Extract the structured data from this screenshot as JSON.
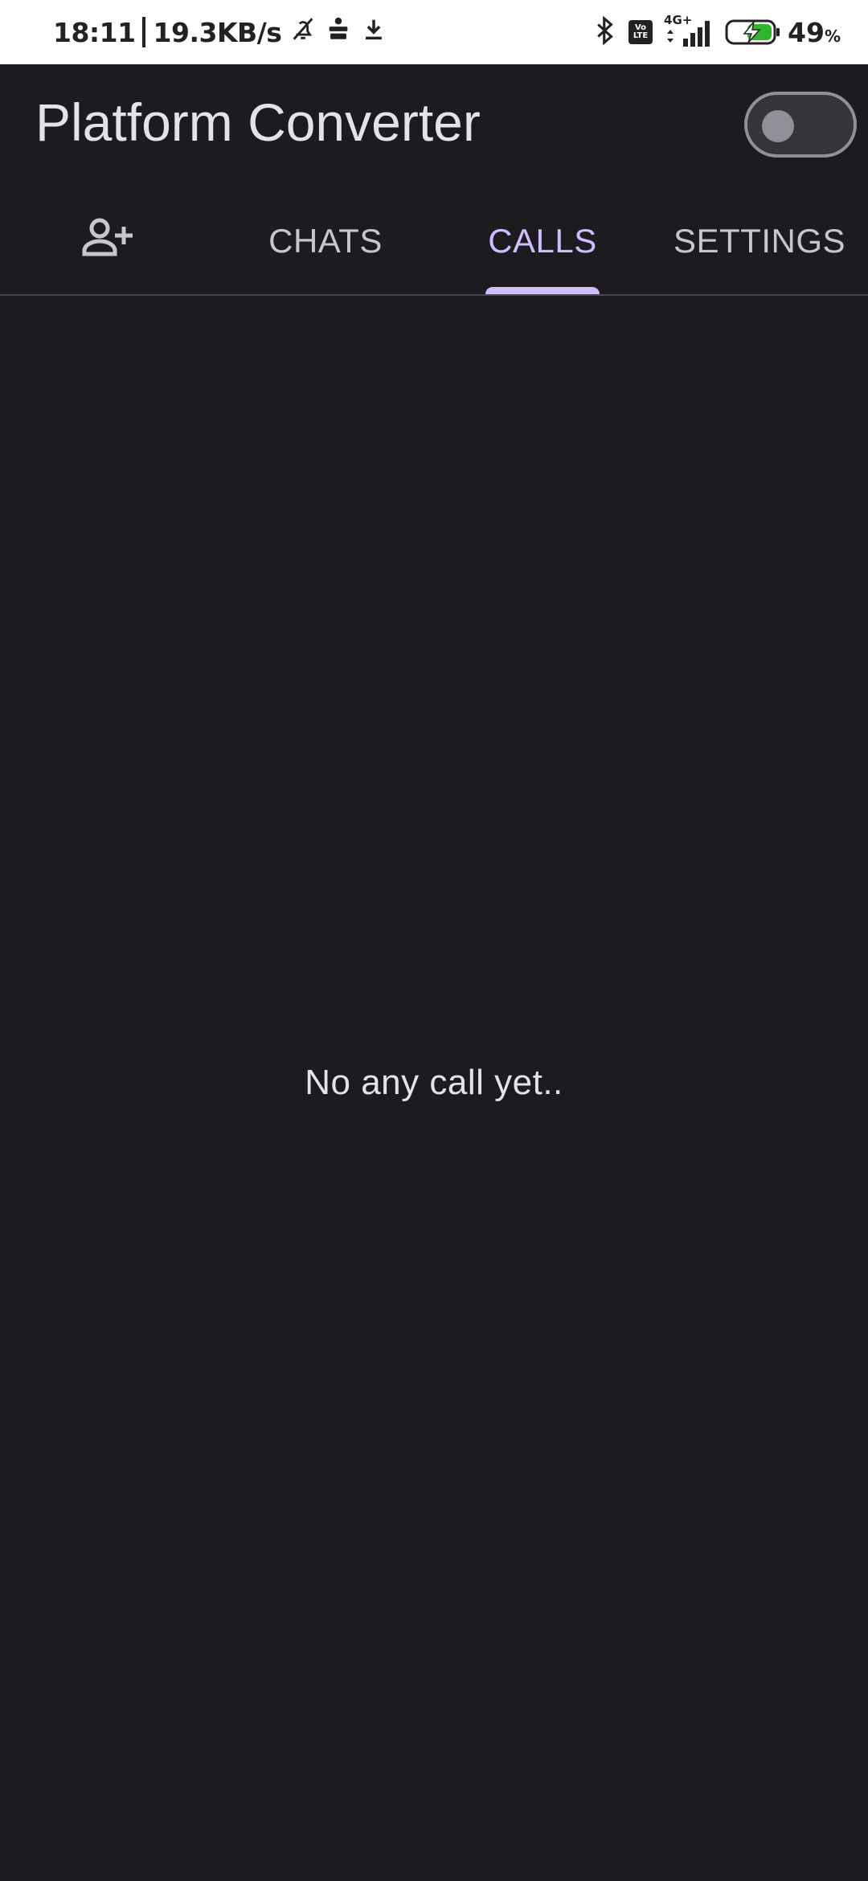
{
  "status_bar": {
    "time": "18:11",
    "network_speed": "19.3KB/s",
    "signal_type": "4G+",
    "volte_label": "Vo LTE",
    "battery_percent": "49",
    "battery_unit": "%",
    "icons": [
      "mute-bell-icon",
      "app-notification-icon",
      "download-icon",
      "bluetooth-icon",
      "volte-icon",
      "signal-icon",
      "battery-charging-icon"
    ]
  },
  "app_bar": {
    "title": "Platform Converter",
    "toggle_on": false
  },
  "tabs": {
    "items": [
      {
        "label": "",
        "icon": "add-person-icon",
        "active": false
      },
      {
        "label": "CHATS",
        "active": false
      },
      {
        "label": "CALLS",
        "active": true
      },
      {
        "label": "SETTINGS",
        "active": false
      }
    ]
  },
  "calls": {
    "empty_message": "No any call yet.."
  },
  "colors": {
    "background": "#1c1b20",
    "accent": "#d0bcff",
    "text": "#e6e1e6",
    "battery": "#2fb52a"
  }
}
